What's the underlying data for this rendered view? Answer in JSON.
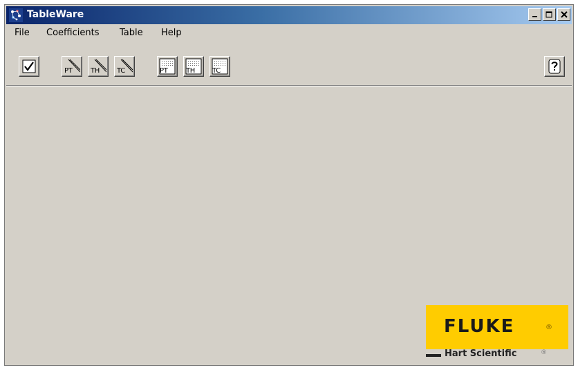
{
  "window": {
    "title": "TableWare",
    "controls": {
      "minimize": "minimize-icon",
      "maximize": "maximize-icon",
      "close": "close-icon"
    }
  },
  "menu": {
    "items": [
      {
        "label": "File"
      },
      {
        "label": "Coefficients"
      },
      {
        "label": "Table"
      },
      {
        "label": "Help"
      }
    ]
  },
  "toolbar": {
    "check_icon": "checkmark-icon",
    "probe_buttons": [
      {
        "label": "PT",
        "icon": "probe-icon"
      },
      {
        "label": "TH",
        "icon": "probe-icon"
      },
      {
        "label": "TC",
        "icon": "probe-icon"
      }
    ],
    "table_buttons": [
      {
        "label": "PT",
        "icon": "table-grid-icon"
      },
      {
        "label": "TH",
        "icon": "table-grid-icon"
      },
      {
        "label": "TC",
        "icon": "table-grid-icon"
      }
    ],
    "help_icon": "help-question-icon"
  },
  "logo": {
    "brand": "FLUKE",
    "brand_reg": "®",
    "subbrand": "Hart Scientific",
    "subbrand_reg": "®",
    "brand_color": "#ffcc00"
  }
}
